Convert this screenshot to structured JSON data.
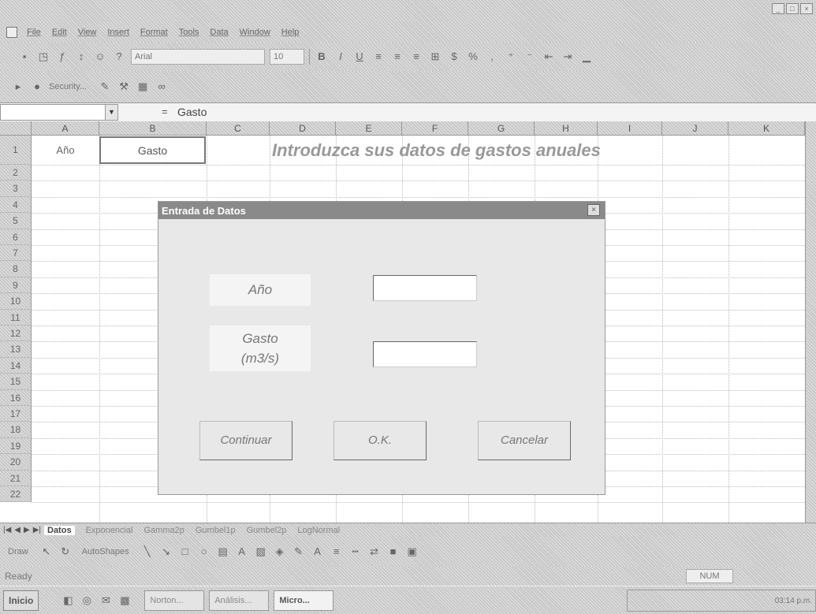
{
  "window": {
    "close_glyph": "×",
    "minimize_glyph": "_",
    "restore_glyph": "□"
  },
  "menu": [
    "File",
    "Edit",
    "View",
    "Insert",
    "Format",
    "Tools",
    "Data",
    "Window",
    "Help"
  ],
  "toolbar": {
    "font_name": "Arial",
    "font_size": "10",
    "bold": "B",
    "italic": "I",
    "underline": "U",
    "security_label": "Security...",
    "percent": "%",
    "comma": ","
  },
  "formula_bar": {
    "equals": "=",
    "value": "Gasto"
  },
  "sheet": {
    "columns": [
      "A",
      "B",
      "C",
      "D",
      "E",
      "F",
      "G",
      "H",
      "I",
      "J",
      "K"
    ],
    "rows": [
      "1",
      "2",
      "3",
      "4",
      "5",
      "6",
      "7",
      "8",
      "9",
      "10",
      "11",
      "12",
      "13",
      "14",
      "15",
      "16",
      "17",
      "18",
      "19",
      "20",
      "21",
      "22"
    ],
    "a1": "Año",
    "b1": "Gasto",
    "title": "Introduzca sus datos de gastos anuales"
  },
  "tabs": [
    "Datos",
    "Exponencial",
    "Gamma2p",
    "Gumbel1p",
    "Gumbel2p",
    "LogNormal"
  ],
  "drawbar": {
    "draw_label": "Draw",
    "autoshapes_label": "AutoShapes"
  },
  "status": {
    "text": "Ready",
    "num": "NUM"
  },
  "taskbar": {
    "start": "Inicio",
    "tasks": [
      "Norton...",
      "Análisis...",
      "Micro..."
    ],
    "clock": "03:14 p.m."
  },
  "dialog": {
    "title": "Entrada de Datos",
    "close_glyph": "×",
    "label_year": "Año",
    "label_flow": "Gasto\n(m3/s)",
    "btn_continue": "Continuar",
    "btn_ok": "O.K.",
    "btn_cancel": "Cancelar"
  }
}
